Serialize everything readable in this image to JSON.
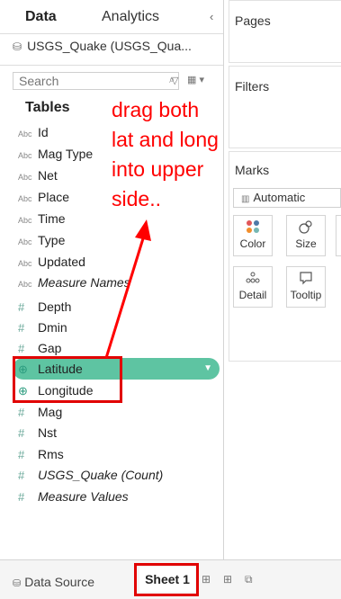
{
  "left_panel": {
    "tabs": [
      {
        "label": "Data"
      },
      {
        "label": "Analytics"
      }
    ],
    "collapse_glyph": "‹",
    "datasource_name": "USGS_Quake (USGS_Qua...",
    "search_placeholder": "Search",
    "tables_heading": "Tables",
    "dimension_fields": [
      "Id",
      "Mag Type",
      "Net",
      "Place",
      "Time",
      "Type",
      "Updated"
    ],
    "measure_names": "Measure Names",
    "measure_fields_top": [
      "Depth",
      "Dmin",
      "Gap"
    ],
    "geo_fields": [
      "Latitude",
      "Longitude"
    ],
    "measure_fields_bottom": [
      "Mag",
      "Nst",
      "Rms"
    ],
    "count_field": "USGS_Quake (Count)",
    "measure_values": "Measure Values",
    "dim_icon": "Abc",
    "measure_icon": "#",
    "geo_icon": "⊕"
  },
  "right_panel": {
    "pages_label": "Pages",
    "filters_label": "Filters",
    "marks_label": "Marks",
    "marks_type": "Automatic",
    "mark_cards": [
      {
        "label": "Color",
        "icon": "color-icon"
      },
      {
        "label": "Size",
        "icon": "size-icon"
      },
      {
        "label": "Detail",
        "icon": "detail-icon"
      },
      {
        "label": "Tooltip",
        "icon": "tooltip-icon"
      }
    ]
  },
  "bottom_bar": {
    "data_source_tab": "Data Source",
    "sheet_tab": "Sheet 1"
  },
  "annotation": {
    "lines": [
      "drag both",
      "lat and long",
      "into upper",
      "side.."
    ],
    "color": "#ff0000"
  },
  "colors": {
    "highlight_pill": "#5ec4a2",
    "highlight_box": "#e10000"
  }
}
